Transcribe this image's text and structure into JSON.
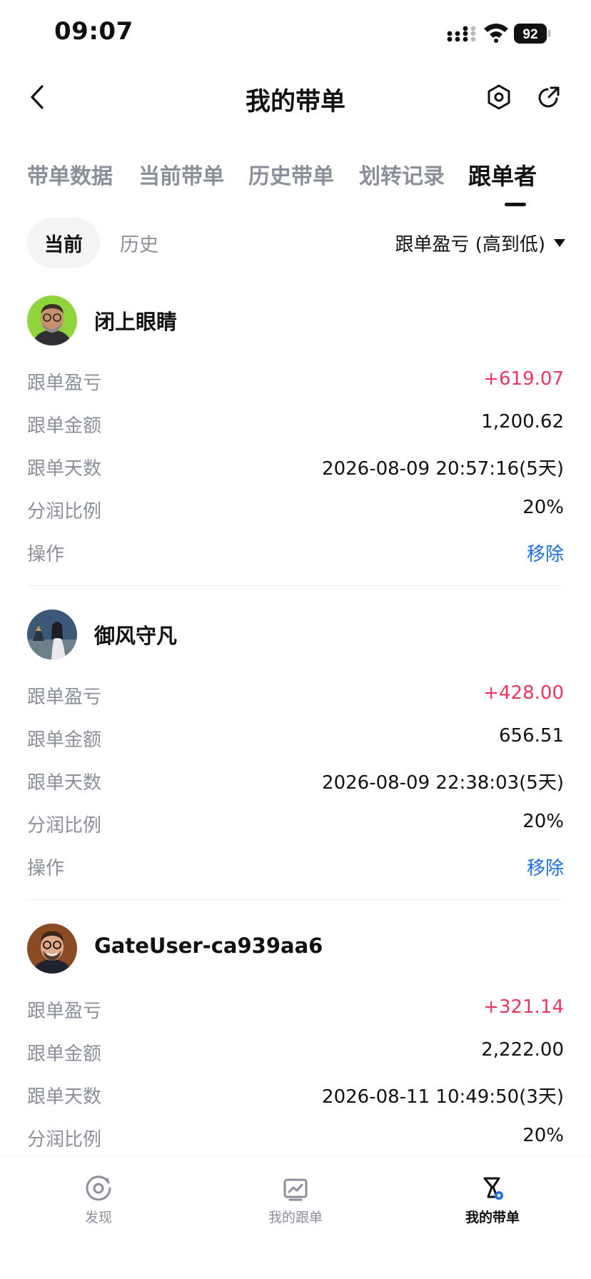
{
  "status_bar": {
    "time": "09:07",
    "battery": "92"
  },
  "header": {
    "title": "我的带单"
  },
  "tabs": [
    {
      "label": "带单数据"
    },
    {
      "label": "当前带单"
    },
    {
      "label": "历史带单"
    },
    {
      "label": "划转记录"
    },
    {
      "label": "跟单者"
    }
  ],
  "active_tab": "跟单者",
  "subtabs": {
    "current": "当前",
    "history": "历史"
  },
  "sort": {
    "label": "跟单盈亏 (高到低)"
  },
  "field_labels": {
    "pnl": "跟单盈亏",
    "amount": "跟单金额",
    "days": "跟单天数",
    "share": "分润比例",
    "action": "操作"
  },
  "followers": [
    {
      "name": "闭上眼睛",
      "pnl": "+619.07",
      "amount": "1,200.62",
      "days": "2026-08-09 20:57:16(5天)",
      "share": "20%",
      "action": "移除"
    },
    {
      "name": "御风守凡",
      "pnl": "+428.00",
      "amount": "656.51",
      "days": "2026-08-09 22:38:03(5天)",
      "share": "20%",
      "action": "移除"
    },
    {
      "name": "GateUser-ca939aa6",
      "pnl": "+321.14",
      "amount": "2,222.00",
      "days": "2026-08-11 10:49:50(3天)",
      "share": "20%",
      "action": ""
    }
  ],
  "bottom_nav": [
    {
      "label": "发现",
      "icon": "discover-icon"
    },
    {
      "label": "我的跟单",
      "icon": "chart-icon"
    },
    {
      "label": "我的带单",
      "icon": "lead-trade-icon"
    }
  ],
  "colors": {
    "profit": "#e8365e",
    "action": "#1f6fe0",
    "muted": "#8a8f99",
    "text": "#111111"
  }
}
